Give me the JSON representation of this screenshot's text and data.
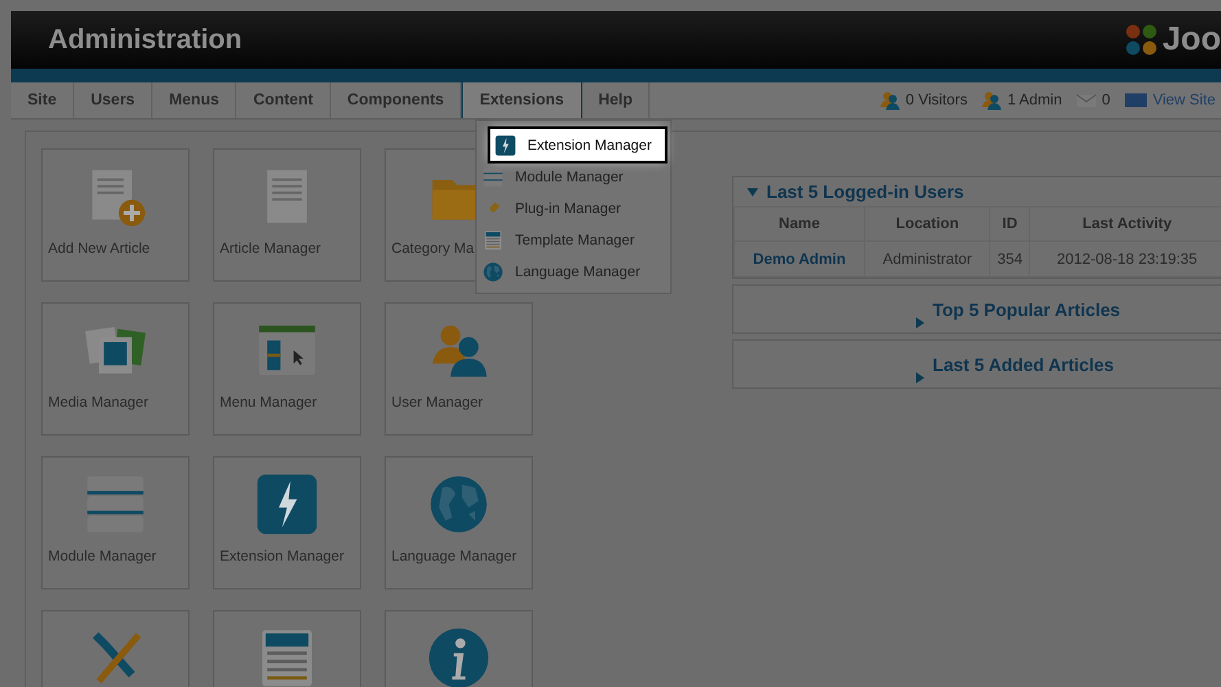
{
  "header": {
    "title": "Administration",
    "logo_text": "Joo"
  },
  "nav": {
    "items": [
      {
        "label": "Site",
        "selected": false
      },
      {
        "label": "Users",
        "selected": false
      },
      {
        "label": "Menus",
        "selected": false
      },
      {
        "label": "Content",
        "selected": false
      },
      {
        "label": "Components",
        "selected": false
      },
      {
        "label": "Extensions",
        "selected": true
      },
      {
        "label": "Help",
        "selected": false
      }
    ]
  },
  "status": [
    {
      "kind": "visitors",
      "label": "0 Visitors"
    },
    {
      "kind": "admin",
      "label": "1 Admin"
    },
    {
      "kind": "messages",
      "label": "0"
    },
    {
      "kind": "site",
      "label": "View Site"
    }
  ],
  "dropdown": {
    "items": [
      {
        "kind": "extension",
        "label": "Extension Manager",
        "selected": true
      },
      {
        "kind": "module",
        "label": "Module Manager",
        "selected": false
      },
      {
        "kind": "plugin",
        "label": "Plug-in Manager",
        "selected": false
      },
      {
        "kind": "template",
        "label": "Template Manager",
        "selected": false
      },
      {
        "kind": "language",
        "label": "Language Manager",
        "selected": false
      }
    ]
  },
  "cards": [
    {
      "kind": "add-article",
      "label": "Add New Article"
    },
    {
      "kind": "article",
      "label": "Article Manager"
    },
    {
      "kind": "folder",
      "label": "Category Ma"
    },
    {
      "kind": "media",
      "label": "Media Manager"
    },
    {
      "kind": "menu",
      "label": "Menu Manager"
    },
    {
      "kind": "users",
      "label": "User Manager"
    },
    {
      "kind": "module",
      "label": "Module Manager"
    },
    {
      "kind": "extension",
      "label": "Extension Manager"
    },
    {
      "kind": "language",
      "label": "Language Manager"
    },
    {
      "kind": "tools"
    },
    {
      "kind": "template"
    },
    {
      "kind": "info"
    }
  ],
  "panels": [
    {
      "title": "Last 5 Logged-in Users",
      "expanded": true,
      "table": {
        "columns": [
          "Name",
          "Location",
          "ID",
          "Last Activity"
        ],
        "rows": [
          [
            "Demo Admin",
            "Administrator",
            "354",
            "2012-08-18 23:19:35"
          ]
        ]
      }
    },
    {
      "title": "Top 5 Popular Articles",
      "expanded": false
    },
    {
      "title": "Last 5 Added Articles",
      "expanded": false
    }
  ]
}
